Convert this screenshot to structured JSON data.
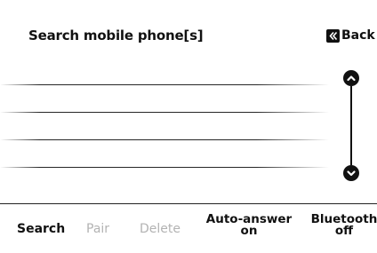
{
  "header": {
    "title": "Search mobile phone[s]",
    "back_label": "Back"
  },
  "device_list": {
    "items": [
      "",
      "",
      "",
      ""
    ]
  },
  "scroll": {
    "up_icon": "chevron-up-icon",
    "down_icon": "chevron-down-icon"
  },
  "bottom_bar": {
    "search_label": "Search",
    "pair_label": "Pair",
    "delete_label": "Delete",
    "auto_answer_line1": "Auto-answer",
    "auto_answer_line2": "on",
    "bluetooth_line1": "Bluetooth",
    "bluetooth_line2": "off"
  },
  "colors": {
    "text": "#111111",
    "disabled_text": "#b3b3b3",
    "background": "#ffffff"
  }
}
